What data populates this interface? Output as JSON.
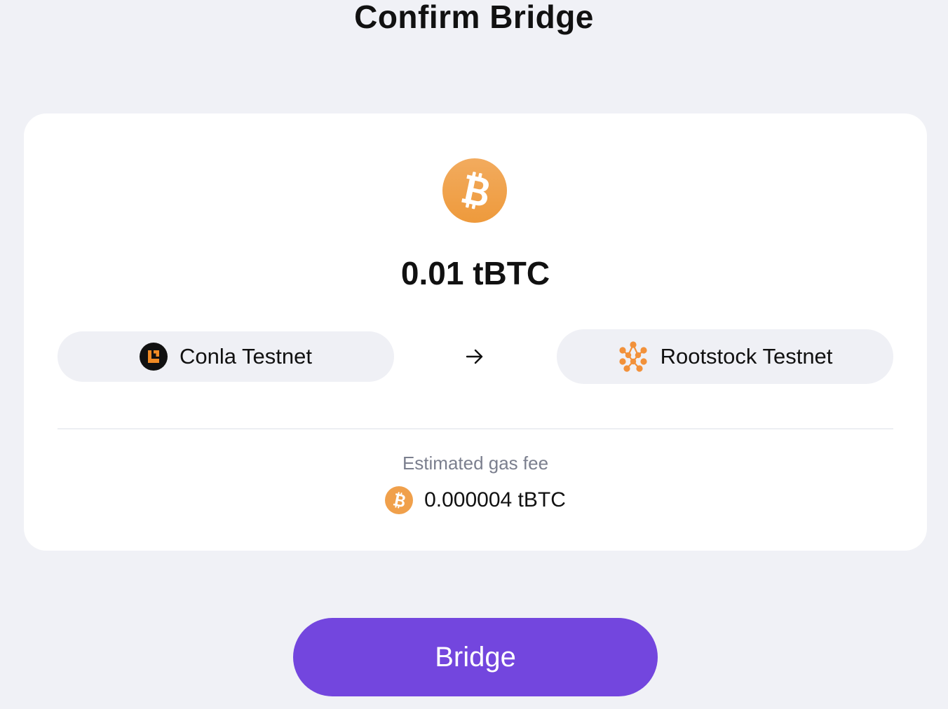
{
  "page": {
    "title": "Confirm Bridge"
  },
  "transfer": {
    "token_icon": "bitcoin-icon",
    "amount": "0.01 tBTC",
    "from_chain": {
      "label": "Conla Testnet",
      "icon": "conla-logo-icon"
    },
    "direction_icon": "arrow-right-icon",
    "to_chain": {
      "label": "Rootstock Testnet",
      "icon": "rootstock-logo-icon"
    }
  },
  "fee": {
    "label": "Estimated gas fee",
    "icon": "bitcoin-icon",
    "value": "0.000004 tBTC"
  },
  "actions": {
    "bridge_label": "Bridge"
  },
  "colors": {
    "background": "#f0f1f6",
    "card": "#ffffff",
    "pill": "#eff0f5",
    "accent": "#7346de",
    "bitcoin_orange": "#f0a04b",
    "rootstock_orange": "#f2913a"
  }
}
